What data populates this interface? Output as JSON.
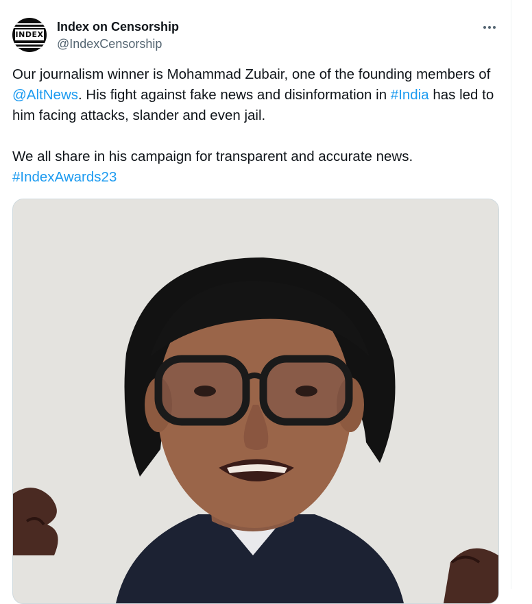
{
  "author": {
    "display_name": "Index on Censorship",
    "handle": "@IndexCensorship",
    "avatar_logo_text": "INDEX"
  },
  "tweet": {
    "p1_a": "Our journalism winner is Mohammad Zubair, one of the founding members of ",
    "p1_mention": "@AltNews",
    "p1_b": ". His fight against fake news and disinformation in ",
    "p1_hashtag": "#India",
    "p1_c": " has led to him facing attacks, slander and even jail.",
    "p2_a": "We all share in his campaign for transparent and accurate news. ",
    "p2_hashtag": "#IndexAwards23"
  },
  "icons": {
    "more": "more-horizontal-icon"
  },
  "colors": {
    "link": "#1d9bf0",
    "text": "#0f1419",
    "secondary": "#536471"
  }
}
